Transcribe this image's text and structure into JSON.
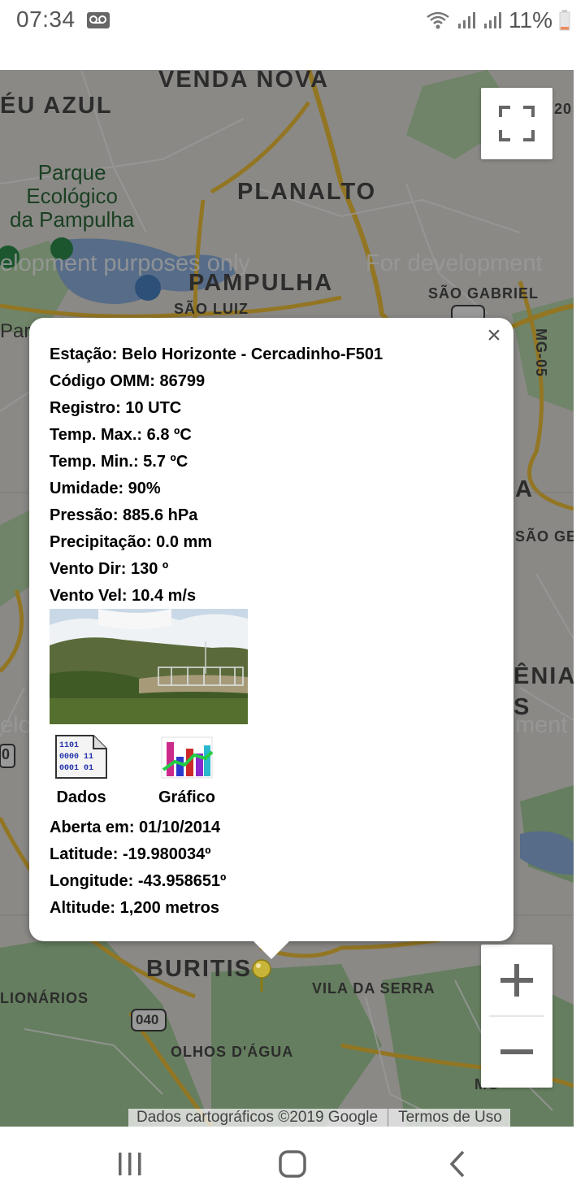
{
  "status_bar": {
    "time": "07:34",
    "battery": "11%"
  },
  "map": {
    "labels": {
      "venda_nova": "VENDA NOVA",
      "eu_azul": "ÉU AZUL",
      "parque": "Parque\nEcológico\nda Pampulha",
      "planalto": "PLANALTO",
      "pampulha": "PAMPULHA",
      "sao_luiz": "SÃO LUIZ",
      "sao_gabriel": "SÃO GABRIEL",
      "mg05": "MG-05",
      "par": "Par",
      "sao_ge": "SÃO GE",
      "enia": "ÊNIA",
      "buritis": "BURITIS",
      "vila_da_serra": "VILA DA SERRA",
      "olhos_dagua": "OLHOS D'ÁGUA",
      "lionarios": "LIONÁRIOS",
      "road_040": "040",
      "a_label": "A",
      "s_label": "S",
      "elo": "elo",
      "zero": "0",
      "num_20": "20",
      "mg_bottom": "MG"
    },
    "watermark_left": "elopment purposes only",
    "watermark_right": "For development",
    "watermark_right2": "ment",
    "attribution": "Dados cartográficos ©2019 Google",
    "terms": "Termos de Uso"
  },
  "popup": {
    "station": "Estação: Belo Horizonte - Cercadinho-F501",
    "omm": "Código OMM: 86799",
    "registro": "Registro: 10 UTC",
    "temp_max": "Temp. Max.: 6.8 ºC",
    "temp_min": "Temp. Min.: 5.7 ºC",
    "umidade": "Umidade: 90%",
    "pressao": "Pressão: 885.6 hPa",
    "precipitacao": "Precipitação: 0.0 mm",
    "vento_dir": "Vento Dir: 130 º",
    "vento_vel": "Vento Vel: 10.4 m/s",
    "dados_label": "Dados",
    "grafico_label": "Gráfico",
    "dados_icon_text": "1101\n0000 11\n0001 01",
    "aberta": "Aberta em: 01/10/2014",
    "latitude": "Latitude: -19.980034º",
    "longitude": "Longitude: -43.958651º",
    "altitude": "Altitude: 1,200 metros",
    "close": "×"
  },
  "icons": {
    "wifi": "wifi-icon",
    "signal": "signal-icon",
    "battery": "battery-icon",
    "voicemail": "voicemail-icon",
    "fullscreen": "fullscreen-icon",
    "zoom_in": "plus-icon",
    "zoom_out": "minus-icon",
    "marker": "map-pin-icon"
  },
  "colors": {
    "battery_low": "#f08a5d",
    "map_road": "#f5c53b",
    "map_water": "#6fa0d8",
    "map_park": "#a8d29e"
  }
}
